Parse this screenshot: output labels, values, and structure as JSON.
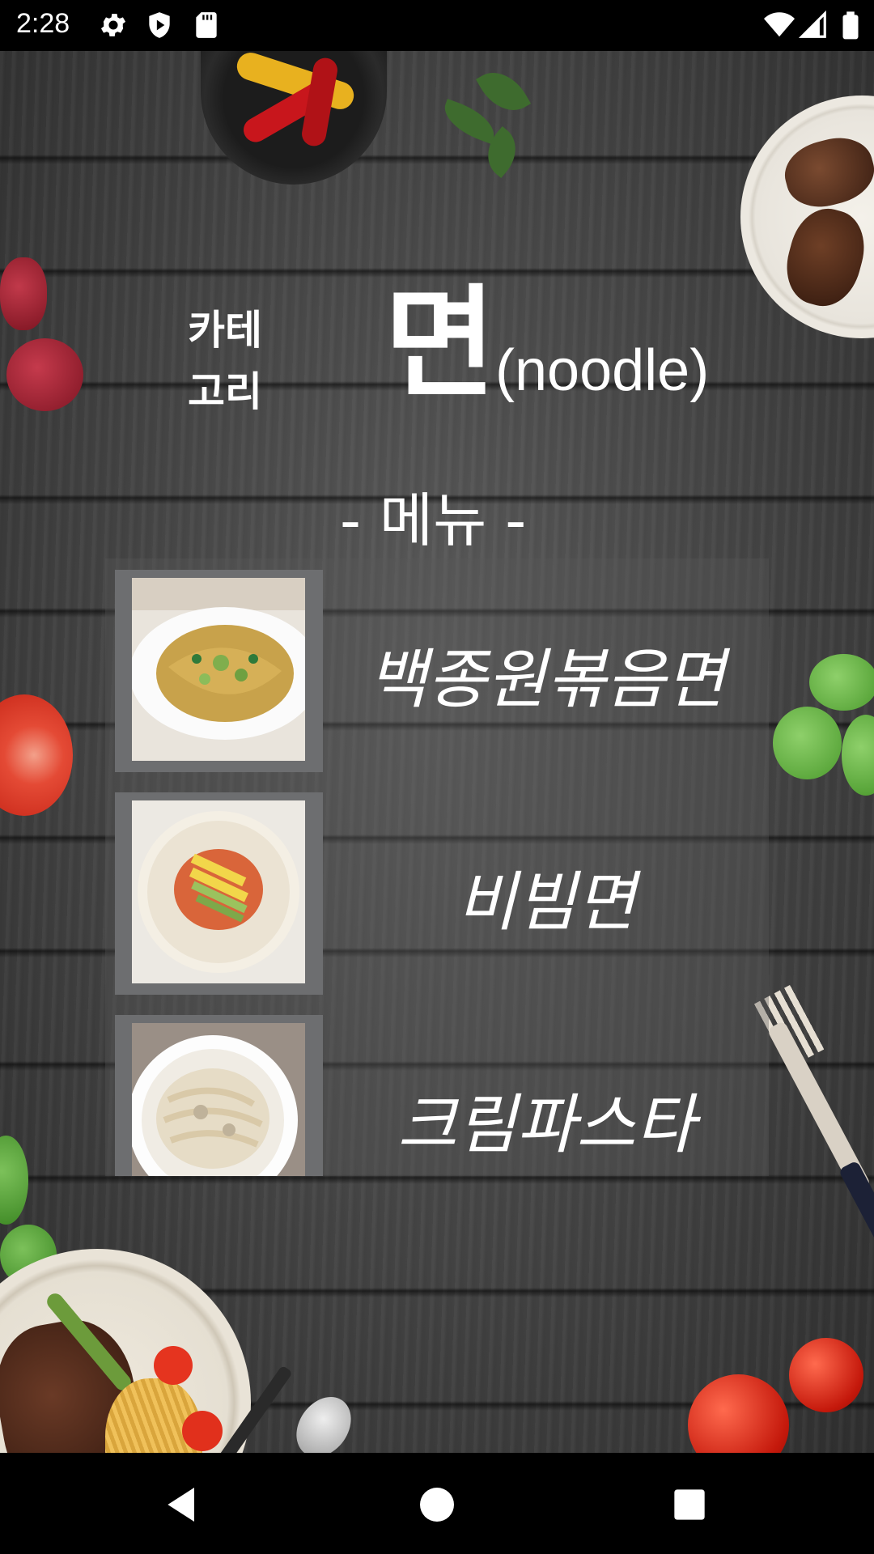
{
  "status_bar": {
    "time": "2:28",
    "left_icons": [
      "gear-icon",
      "play-protect-icon",
      "sd-card-icon"
    ],
    "right_icons": [
      "wifi-icon",
      "signal-icon",
      "battery-icon"
    ]
  },
  "header": {
    "category_label_line1": "카테",
    "category_label_line2": "고리",
    "title": "면",
    "title_sub": "(noodle)"
  },
  "menu": {
    "heading": "- 메뉴 -",
    "items": [
      {
        "name": "백종원볶음면",
        "image": "stir-fried-noodles-photo"
      },
      {
        "name": "비빔면",
        "image": "bibim-noodles-photo"
      },
      {
        "name": "크림파스타",
        "image": "cream-pasta-photo"
      }
    ]
  },
  "nav_bar": {
    "buttons": [
      "back-icon",
      "home-icon",
      "recents-icon"
    ]
  },
  "colors": {
    "text": "#ffffff",
    "thumb_frame": "#6d6e70",
    "background": "#474747"
  }
}
